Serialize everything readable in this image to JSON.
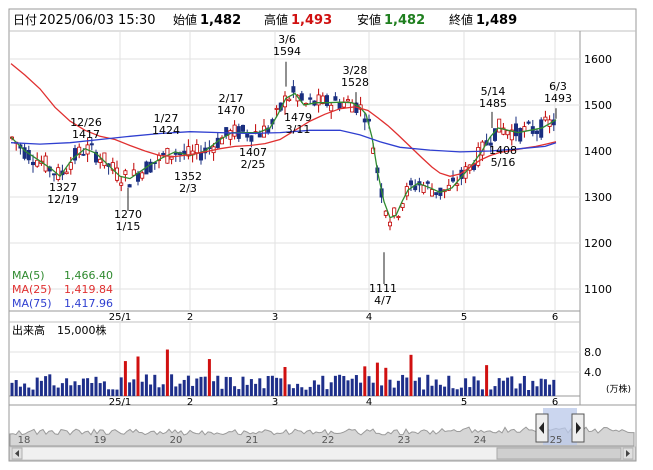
{
  "header": {
    "date_label": "日付",
    "datetime": "2025/06/03 15:30",
    "open_label": "始値",
    "open_value": "1,482",
    "high_label": "高値",
    "high_value": "1,493",
    "low_label": "安値",
    "low_value": "1,482",
    "close_label": "終値",
    "close_value": "1,489"
  },
  "legend": {
    "ma5_label": "MA(5)",
    "ma5_value": "1,466.40",
    "ma25_label": "MA(25)",
    "ma25_value": "1,419.84",
    "ma75_label": "MA(75)",
    "ma75_value": "1,417.96"
  },
  "volume": {
    "title": "出来高",
    "scale_note": "15,000株",
    "unit": "(万株)",
    "y_ticks": [
      "8.0",
      "4.0"
    ]
  },
  "colors": {
    "up": "#c00000",
    "down": "#1a2f80",
    "ma5": "#2f8a2f",
    "ma25": "#e03030",
    "ma75": "#2f3fd0",
    "volume_normal": "#1e2f8a",
    "volume_high": "#d01010",
    "high_value": "#d01010",
    "low_value": "#1f7f1f"
  },
  "chart_data": {
    "type": "candlestick",
    "price_axis": {
      "ticks": [
        1600,
        1500,
        1400,
        1300,
        1200,
        1100
      ],
      "range": [
        1060,
        1650
      ]
    },
    "x_tick_labels": [
      "25/1",
      "2",
      "3",
      "4",
      "5",
      "6"
    ],
    "annotations": [
      {
        "top": "12/26",
        "bottom": "1417"
      },
      {
        "top": "1327",
        "bottom": "12/19"
      },
      {
        "top": "1/27",
        "bottom": "1424"
      },
      {
        "top": "1270",
        "bottom": "1/15"
      },
      {
        "top": "1352",
        "bottom": "2/3"
      },
      {
        "top": "2/17",
        "bottom": "1470"
      },
      {
        "top": "1407",
        "bottom": "2/25"
      },
      {
        "top": "3/6",
        "bottom": "1594"
      },
      {
        "top": "1479",
        "bottom": "3/11"
      },
      {
        "top": "3/28",
        "bottom": "1528"
      },
      {
        "top": "1111",
        "bottom": "4/7"
      },
      {
        "top": "5/14",
        "bottom": "1485"
      },
      {
        "top": "1408",
        "bottom": "5/16"
      },
      {
        "top": "6/3",
        "bottom": "1493"
      }
    ],
    "ma5": [
      [
        11,
        1430
      ],
      [
        25,
        1400
      ],
      [
        40,
        1378
      ],
      [
        52,
        1360
      ],
      [
        60,
        1345
      ],
      [
        72,
        1382
      ],
      [
        85,
        1405
      ],
      [
        96,
        1395
      ],
      [
        108,
        1370
      ],
      [
        120,
        1345
      ],
      [
        130,
        1340
      ],
      [
        140,
        1355
      ],
      [
        150,
        1370
      ],
      [
        162,
        1385
      ],
      [
        175,
        1398
      ],
      [
        190,
        1390
      ],
      [
        205,
        1400
      ],
      [
        220,
        1425
      ],
      [
        232,
        1440
      ],
      [
        245,
        1440
      ],
      [
        258,
        1440
      ],
      [
        270,
        1450
      ],
      [
        278,
        1480
      ],
      [
        286,
        1515
      ],
      [
        295,
        1525
      ],
      [
        304,
        1500
      ],
      [
        316,
        1505
      ],
      [
        328,
        1505
      ],
      [
        340,
        1506
      ],
      [
        352,
        1505
      ],
      [
        360,
        1495
      ],
      [
        366,
        1480
      ],
      [
        372,
        1430
      ],
      [
        378,
        1350
      ],
      [
        384,
        1290
      ],
      [
        390,
        1255
      ],
      [
        396,
        1260
      ],
      [
        402,
        1290
      ],
      [
        408,
        1315
      ],
      [
        418,
        1330
      ],
      [
        430,
        1320
      ],
      [
        440,
        1310
      ],
      [
        452,
        1320
      ],
      [
        462,
        1345
      ],
      [
        472,
        1370
      ],
      [
        482,
        1400
      ],
      [
        490,
        1430
      ],
      [
        498,
        1450
      ],
      [
        508,
        1445
      ],
      [
        518,
        1440
      ],
      [
        530,
        1445
      ],
      [
        542,
        1450
      ],
      [
        550,
        1460
      ],
      [
        556,
        1468
      ]
    ],
    "ma25": [
      [
        11,
        1590
      ],
      [
        25,
        1565
      ],
      [
        40,
        1535
      ],
      [
        55,
        1495
      ],
      [
        70,
        1465
      ],
      [
        85,
        1445
      ],
      [
        100,
        1432
      ],
      [
        115,
        1425
      ],
      [
        130,
        1412
      ],
      [
        145,
        1400
      ],
      [
        160,
        1390
      ],
      [
        175,
        1388
      ],
      [
        190,
        1392
      ],
      [
        205,
        1398
      ],
      [
        220,
        1405
      ],
      [
        235,
        1410
      ],
      [
        250,
        1412
      ],
      [
        265,
        1416
      ],
      [
        280,
        1425
      ],
      [
        295,
        1445
      ],
      [
        310,
        1465
      ],
      [
        325,
        1480
      ],
      [
        340,
        1492
      ],
      [
        355,
        1496
      ],
      [
        368,
        1488
      ],
      [
        378,
        1472
      ],
      [
        388,
        1455
      ],
      [
        398,
        1435
      ],
      [
        410,
        1410
      ],
      [
        422,
        1385
      ],
      [
        432,
        1365
      ],
      [
        440,
        1352
      ],
      [
        450,
        1345
      ],
      [
        460,
        1350
      ],
      [
        470,
        1365
      ],
      [
        480,
        1380
      ],
      [
        490,
        1390
      ],
      [
        500,
        1397
      ],
      [
        512,
        1401
      ],
      [
        524,
        1406
      ],
      [
        536,
        1410
      ],
      [
        546,
        1415
      ],
      [
        556,
        1420
      ]
    ],
    "ma75": [
      [
        11,
        1418
      ],
      [
        40,
        1415
      ],
      [
        70,
        1418
      ],
      [
        100,
        1425
      ],
      [
        130,
        1432
      ],
      [
        160,
        1438
      ],
      [
        190,
        1442
      ],
      [
        220,
        1440
      ],
      [
        250,
        1438
      ],
      [
        280,
        1440
      ],
      [
        310,
        1445
      ],
      [
        340,
        1445
      ],
      [
        360,
        1435
      ],
      [
        380,
        1420
      ],
      [
        400,
        1408
      ],
      [
        430,
        1402
      ],
      [
        460,
        1398
      ],
      [
        490,
        1400
      ],
      [
        520,
        1405
      ],
      [
        545,
        1410
      ],
      [
        556,
        1418
      ]
    ]
  }
}
